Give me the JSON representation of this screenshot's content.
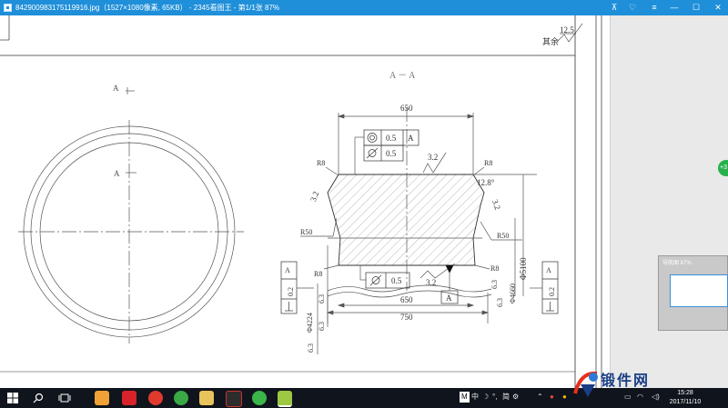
{
  "window": {
    "title": "842900983175119916.jpg（1527×1080像素, 65KB） - 2345看图王 - 第1/1张 87%",
    "controls": {
      "pin": "⊼",
      "skin": "♡",
      "menu": "≡",
      "minimize": "—",
      "maximize": "☐",
      "close": "✕"
    }
  },
  "drawing": {
    "roughness_top": "12.5",
    "roughness_rest": "其余",
    "section_label": "A － A",
    "cut_label": "A",
    "circle_label": "A",
    "dim_650_top": "650",
    "dim_650_bottom": "650",
    "dim_750": "750",
    "fcf_concentric_value": "0.5",
    "fcf_datum": "A",
    "fcf_round_value": "0.5",
    "fcf_bottom_value": "0.5",
    "datum_box": "A",
    "roughness_32_top": "3.2",
    "roughness_32_left": "3.2",
    "roughness_32_right": "3.2",
    "roughness_32_bottom": "3.2",
    "angle": "12.8°",
    "r8_tl": "R8",
    "r8_tr": "R8",
    "r8_bl": "R8",
    "r8_br": "R8",
    "r50_left": "R50",
    "r50_right": "R50",
    "phi_5100": "Φ5100",
    "phi_4660": "Φ4660",
    "phi_4224": "Φ4224",
    "r63_a": "6.3",
    "r63_b": "6.3",
    "r63_c": "6.3",
    "r63_d": "6.3",
    "r63_e": "6.3",
    "left_tol_value": "0.2",
    "left_tol_datum": "A",
    "right_tol_value": "0.2",
    "right_tol_datum": "A"
  },
  "side": {
    "plus_label": "+3",
    "thumb_title": "导航图 87%"
  },
  "taskbar": {
    "ime_items": [
      "M",
      "中",
      "☽",
      "°,",
      "简",
      "⚙"
    ],
    "clock_time": "15:28",
    "clock_date": "2017/11/10",
    "watermark_text": "锻件网"
  },
  "colors": {
    "titlebar": "#1e8fd8",
    "taskbar": "#10141c",
    "drawing_line": "#555555"
  }
}
